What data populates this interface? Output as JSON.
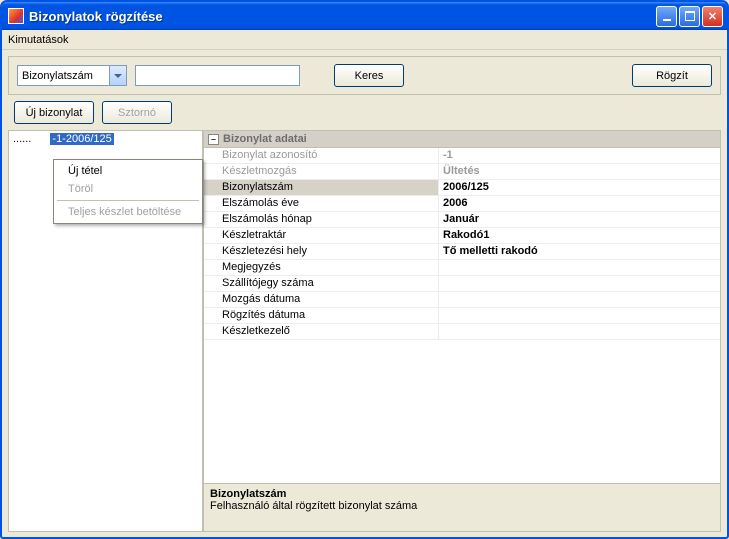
{
  "window": {
    "title": "Bizonylatok rögzítése"
  },
  "menu": {
    "item1": "Kimutatások"
  },
  "toolbar": {
    "combo_value": "Bizonylatszám",
    "search_btn": "Keres",
    "save_btn": "Rögzít",
    "new_btn": "Új bizonylat",
    "storno_btn": "Sztornó"
  },
  "tree": {
    "root": "......",
    "selected": "-1-2006/125"
  },
  "context_menu": {
    "new_item": "Új tétel",
    "delete": "Töröl",
    "load_all": "Teljes készlet betöltése"
  },
  "propgrid": {
    "header": "Bizonylat adatai",
    "rows": [
      {
        "label": "Bizonylat azonosító",
        "value": "-1",
        "dim": true
      },
      {
        "label": "Készletmozgás",
        "value": "Ültetés",
        "dim": true
      },
      {
        "label": "Bizonylatszám",
        "value": "2006/125",
        "sel": true
      },
      {
        "label": "Elszámolás éve",
        "value": "2006"
      },
      {
        "label": "Elszámolás hónap",
        "value": "Január"
      },
      {
        "label": "Készletraktár",
        "value": "Rakodó1"
      },
      {
        "label": "Készletezési hely",
        "value": "Tő melletti rakodó"
      },
      {
        "label": "Megjegyzés",
        "value": ""
      },
      {
        "label": "Szállítójegy száma",
        "value": ""
      },
      {
        "label": "Mozgás dátuma",
        "value": ""
      },
      {
        "label": "Rögzítés dátuma",
        "value": ""
      },
      {
        "label": "Készletkezelő",
        "value": ""
      }
    ],
    "help_title": "Bizonylatszám",
    "help_text": "Felhasználó által rögzített bizonylat száma"
  }
}
